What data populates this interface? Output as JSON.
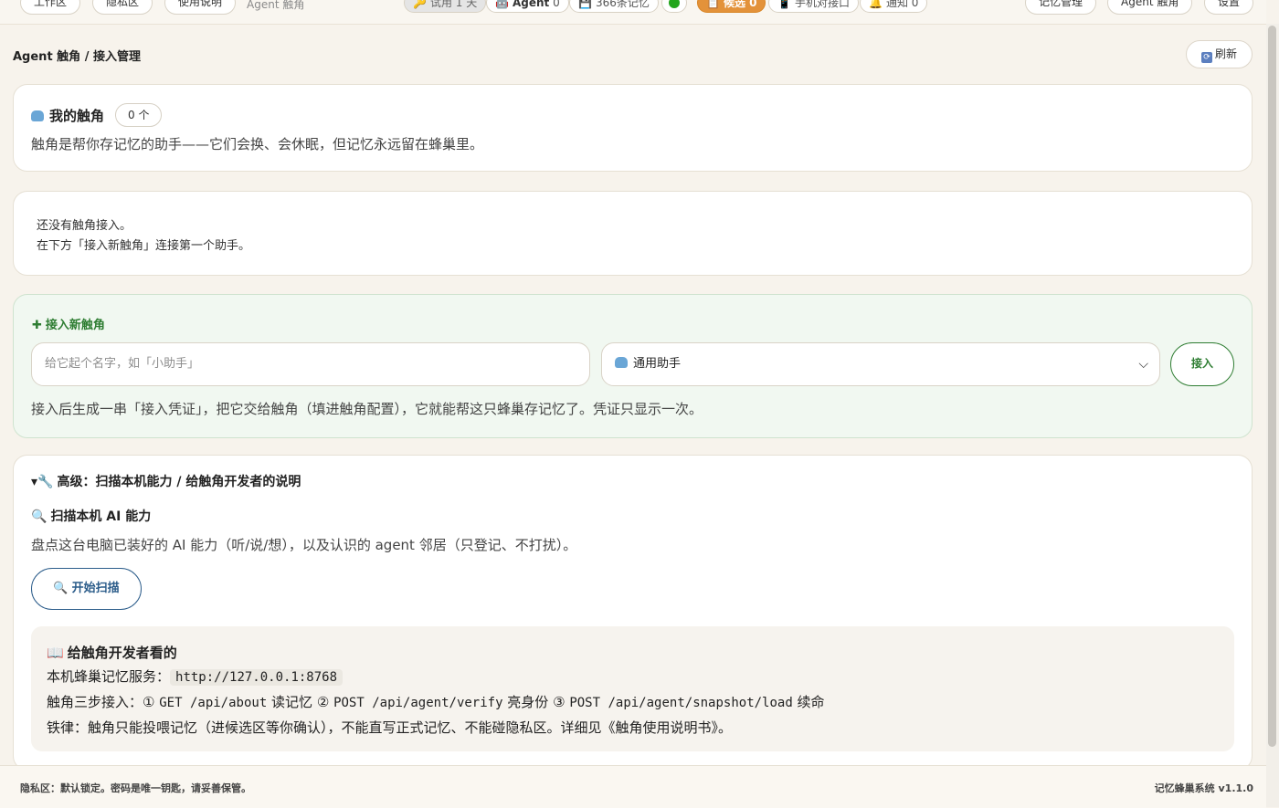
{
  "topbar": {
    "nav_left": [
      "工作区",
      "隐私区",
      "使用说明"
    ],
    "current_page": "Agent 触角",
    "status_pills": {
      "trial": "试用 1 天",
      "agent_label": "Agent",
      "agent_count": "0",
      "memories": "366条记忆",
      "candidate": "候选 0",
      "mobile": "手机对接口",
      "notify": "通知 0"
    },
    "nav_right": [
      "记忆管理",
      "Agent 触角",
      "设置"
    ]
  },
  "header": {
    "breadcrumb": "Agent 触角 / 接入管理",
    "refresh_label": "刷新"
  },
  "my_tentacles": {
    "title": "我的触角",
    "count": "0 个",
    "description": "触角是帮你存记忆的助手——它们会换、会休眠，但记忆永远留在蜂巢里。"
  },
  "empty_state": {
    "line1": "还没有触角接入。",
    "line2": "在下方「接入新触角」连接第一个助手。"
  },
  "add_new": {
    "title": "接入新触角",
    "name_placeholder": "给它起个名字，如「小助手」",
    "type_selected": "通用助手",
    "connect_label": "接入",
    "note": "接入后生成一串「接入凭证」，把它交给触角（填进触角配置），它就能帮这只蜂巢存记忆了。凭证只显示一次。"
  },
  "advanced": {
    "summary": "高级：扫描本机能力 / 给触角开发者的说明",
    "scan_title": "扫描本机 AI 能力",
    "scan_desc": "盘点这台电脑已装好的 AI 能力（听/说/想），以及认识的 agent 邻居（只登记、不打扰）。",
    "scan_button": "开始扫描",
    "dev": {
      "title": "给触角开发者看的",
      "service_label": "本机蜂巢记忆服务：",
      "service_url": "http://127.0.0.1:8768",
      "steps_label": "触角三步接入：",
      "step1_no": "①",
      "step1_method": "GET /api/about",
      "step1_text": "读记忆",
      "step2_no": "②",
      "step2_method": "POST /api/agent/verify",
      "step2_text": "亮身份",
      "step3_no": "③",
      "step3_method": "POST /api/agent/snapshot/load",
      "step3_text": "续命",
      "rule": "铁律：触角只能投喂记忆（进候选区等你确认），不能直写正式记忆、不能碰隐私区。详细见《触角使用说明书》。"
    }
  },
  "footer": {
    "left": "隐私区：默认锁定。密码是唯一钥匙，请妥善保管。",
    "right": "记忆蜂巢系统 v1.1.0"
  }
}
